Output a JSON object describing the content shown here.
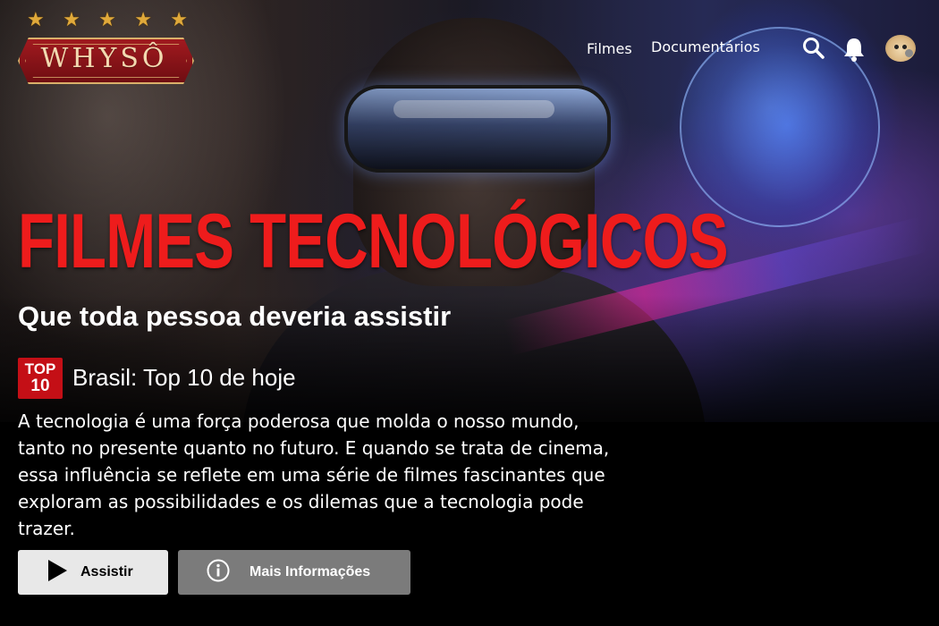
{
  "brand": {
    "logo_text": "WHYSÔ",
    "stars": [
      "★",
      "★",
      "★",
      "★",
      "★"
    ]
  },
  "nav": {
    "links": [
      "Filmes",
      "Documentários"
    ],
    "icons": [
      "search-icon",
      "bell-icon",
      "avatar"
    ]
  },
  "hero": {
    "title": "FILMES TECNOLÓGICOS",
    "subtitle": "Que toda pessoa deveria assistir",
    "badge": {
      "line1": "TOP",
      "line2": "10"
    },
    "ranking": "Brasil: Top 10 de hoje",
    "description": "A tecnologia é uma força poderosa que molda o nosso mundo, tanto no presente quanto no futuro. E quando se trata de cinema, essa influência se reflete em uma série de filmes fascinantes que exploram as possibilidades e os dilemas que a tecnologia pode trazer."
  },
  "actions": {
    "play_label": "Assistir",
    "info_label": "Mais Informações"
  },
  "colors": {
    "title_red": "#ee1c1c",
    "badge_red": "#c40f16",
    "logo_red": "#a11a1f",
    "logo_gold": "#d9b06a",
    "play_bg": "#e8e8e8",
    "info_bg": "#7b7b7b"
  }
}
